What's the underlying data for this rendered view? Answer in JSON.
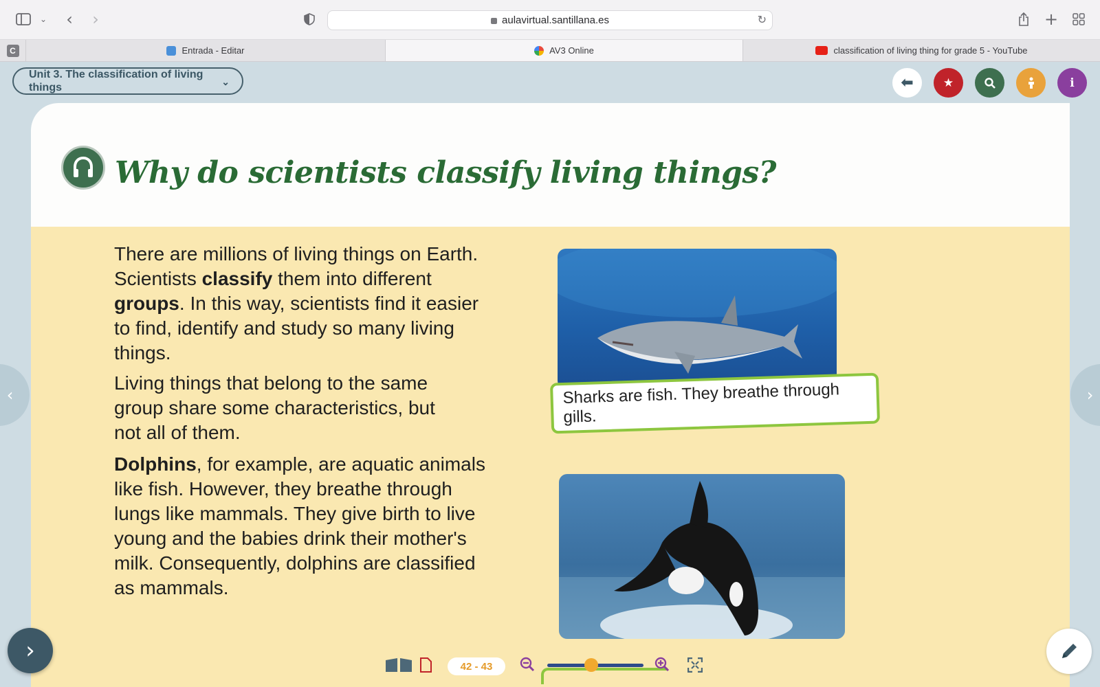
{
  "browser": {
    "url": "aulavirtual.santillana.es",
    "tabs": [
      {
        "label": "Entrada - Editar",
        "icon": "blogger-icon",
        "active": false
      },
      {
        "label": "AV3 Online",
        "icon": "av3-icon",
        "active": true
      },
      {
        "label": "classification of living thing for grade 5 - YouTube",
        "icon": "youtube-icon",
        "active": false
      }
    ],
    "pinned_tab": "C"
  },
  "app": {
    "unit_selector": "Unit 3. The classification of living things",
    "title": "Why do scientists classify living things?",
    "paragraph1": {
      "p1": "There are millions of living things on Earth. Scientists ",
      "b1": "classify",
      "p2": " them into different ",
      "b2": "groups",
      "p3": ". In this way, scientists find it easier to find, identify and study so many living things."
    },
    "paragraph2": "Living things that belong to the same group share some characteristics, but not all of them.",
    "paragraph3": {
      "b1": "Dolphins",
      "p1": ", for example, are aquatic animals like fish. However, they breathe through lungs like mammals. They give birth to live young and the babies drink their mother's milk. Consequently, dolphins are classified as mammals."
    },
    "caption1": "Sharks are fish. They breathe through gills.",
    "page_range": "42 - 43",
    "zoom_level": 0.45,
    "colors": {
      "title_green": "#2a6b35",
      "yellow_panel": "#fae8b1",
      "caption_border": "#8dc63f",
      "btn_red": "#c0232a",
      "btn_green": "#3e6f4f",
      "btn_orange": "#e9a23b",
      "btn_purple": "#8a3f9e"
    }
  }
}
